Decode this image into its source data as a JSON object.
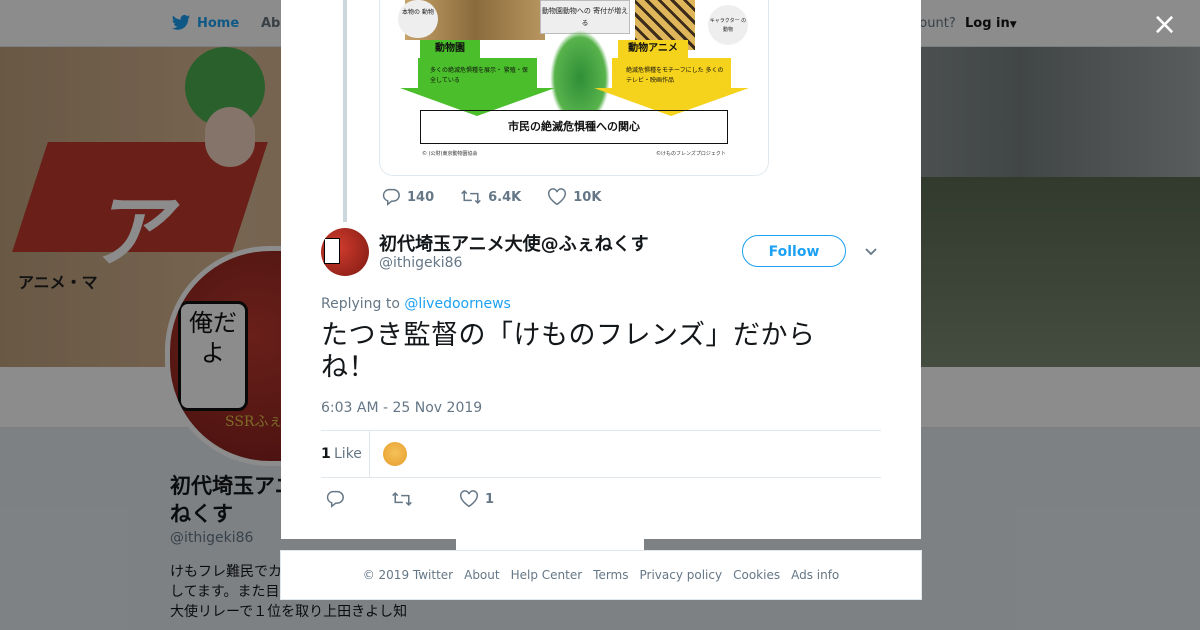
{
  "background": {
    "nav": {
      "home": "Home",
      "about": "Abo",
      "account": "ccount?",
      "login": "Log in"
    },
    "banner_text": "アニメ・マ",
    "banner_big": "ア",
    "avatar_bubble": "俺だよ",
    "avatar_sub": "SSRふぇ",
    "profile": {
      "name": "初代埼玉アニ ねくす",
      "handle": "@ithigeki86",
      "bio": "けもフレ難民でカ 玉祭や舞台めぐり 等してます。また目指せ第一回埼玉アニ メ大使リレーで１位を取り上田きよし知"
    }
  },
  "modal": {
    "close_label": "×",
    "infographic": {
      "box_top": "動物園動物への 寄付が増える",
      "circle_left": "本物の 動物",
      "circle_right": "キャラクター の動物",
      "zoo_label": "動物園",
      "anime_label": "動物アニメ",
      "zoo_desc": "多くの絶滅危惧種を展示・ 繁殖・保全している",
      "anime_desc": "絶滅危惧種をモチーフにした 多くのテレビ・映画作品",
      "result": "市民の絶滅危惧種への関心",
      "copy_left": "© (公財)東京動物園協会",
      "copy_right": "©けものフレンズプロジェクト"
    },
    "parent_actions": {
      "replies": "140",
      "retweets": "6.4K",
      "likes": "10K"
    },
    "tweet": {
      "name": "初代埼玉アニメ大使@ふぇねくす",
      "handle": "@ithigeki86",
      "follow_label": "Follow",
      "replying_prefix": "Replying to",
      "replying_to": "@livedoornews",
      "text_line1": "たつき監督の「けものフレンズ」だから",
      "text_line2": "ね！",
      "time": "6:03 AM - 25 Nov 2019",
      "like_count": "1",
      "like_label": "Like",
      "action_like_count": "1"
    }
  },
  "footer": {
    "items": [
      "© 2019 Twitter",
      "About",
      "Help Center",
      "Terms",
      "Privacy policy",
      "Cookies",
      "Ads info"
    ]
  },
  "colors": {
    "accent": "#1da1f2",
    "muted": "#657786",
    "text": "#14171a"
  }
}
